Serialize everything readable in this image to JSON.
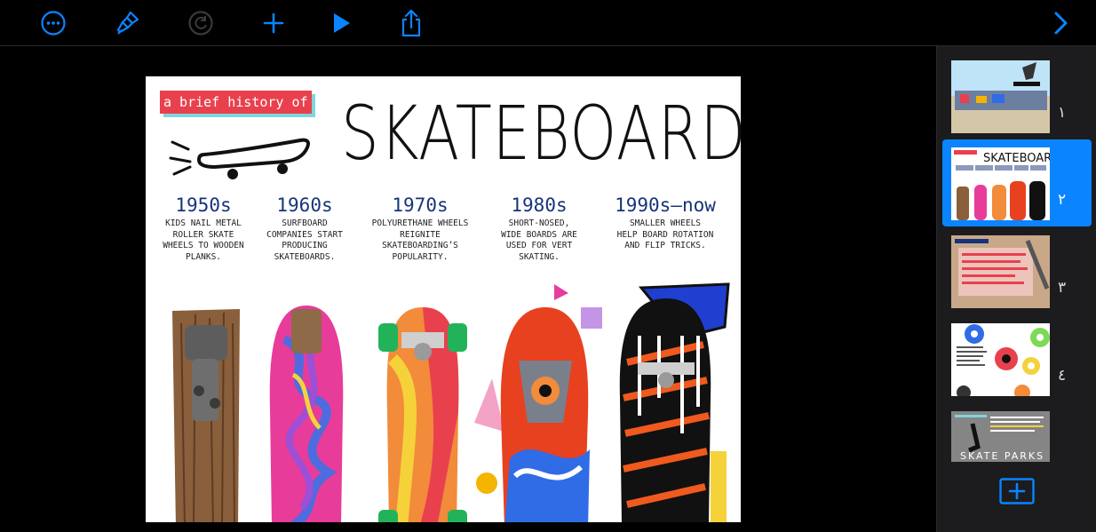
{
  "toolbar": {
    "icons": [
      "more-icon",
      "format-brush-icon",
      "redo-icon",
      "add-icon",
      "play-icon",
      "share-icon",
      "chevron-right-icon"
    ],
    "accent": "#0a84ff",
    "disabled_color": "#3a3a3c"
  },
  "slide": {
    "kicker": "a brief history of",
    "title": "SKATEBOARDS",
    "eras": [
      {
        "year": "1950s",
        "desc": "KIDS NAIL METAL\nROLLER SKATE\nWHEELS TO WOODEN\nPLANKS."
      },
      {
        "year": "1960s",
        "desc": "SURFBOARD\nCOMPANIES START\nPRODUCING\nSKATEBOARDS."
      },
      {
        "year": "1970s",
        "desc": "POLYURETHANE WHEELS\nREIGNITE\nSKATEBOARDING’S\nPOPULARITY."
      },
      {
        "year": "1980s",
        "desc": "SHORT-NOSED,\nWIDE BOARDS ARE\nUSED FOR VERT\nSKATING."
      },
      {
        "year": "1990s—now",
        "desc": "SMALLER WHEELS\nHELP BOARD ROTATION\nAND FLIP TRICKS."
      }
    ],
    "colors": {
      "kicker_bg": "#e8414d",
      "kicker_shadow": "#7fd6dc",
      "year_text": "#17337a"
    }
  },
  "navigator": {
    "selected_index": 1,
    "slides": [
      {
        "number": "١"
      },
      {
        "number": "٢"
      },
      {
        "number": "٣"
      },
      {
        "number": "٤"
      },
      {
        "number": ""
      }
    ],
    "thumb_texts": {
      "s2_title": "SKATEBOARDS",
      "s5_title": "SKATE PARKS"
    }
  }
}
